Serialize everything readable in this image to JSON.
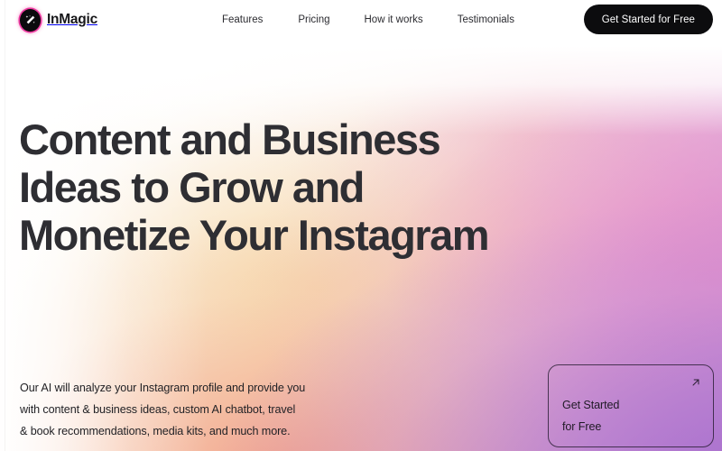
{
  "brand": {
    "name": "InMagic",
    "logo_icon": "magic-wand-icon",
    "ring_color": "#ef3ba2",
    "mark_color": "#0b0b0d"
  },
  "nav": {
    "items": [
      {
        "label": "Features"
      },
      {
        "label": "Pricing"
      },
      {
        "label": "How it works"
      },
      {
        "label": "Testimonials"
      }
    ]
  },
  "header": {
    "cta_label": "Get Started for Free",
    "cta_bg": "#0c0c0e",
    "cta_text_color": "#ffffff"
  },
  "hero": {
    "title_lines": [
      "Content and Business",
      "Ideas to Grow and",
      "Monetize Your Instagram"
    ],
    "title_color": "#2e2e33",
    "subtitle_lines": [
      "Our AI will analyze your Instagram profile and provide you",
      "with content & business ideas, custom AI chatbot, travel",
      "& book recommendations, media kits, and much more."
    ],
    "subtitle_color": "#222226"
  },
  "cta_card": {
    "lines": [
      "Get Started",
      "for Free"
    ],
    "arrow_icon": "arrow-up-right-icon",
    "border_color": "#231930"
  },
  "background": {
    "stops": [
      "#ffffff",
      "#fdf6f2",
      "#f9e7d2",
      "#f3b9bd",
      "#dd93cf",
      "#b27fd2"
    ]
  }
}
